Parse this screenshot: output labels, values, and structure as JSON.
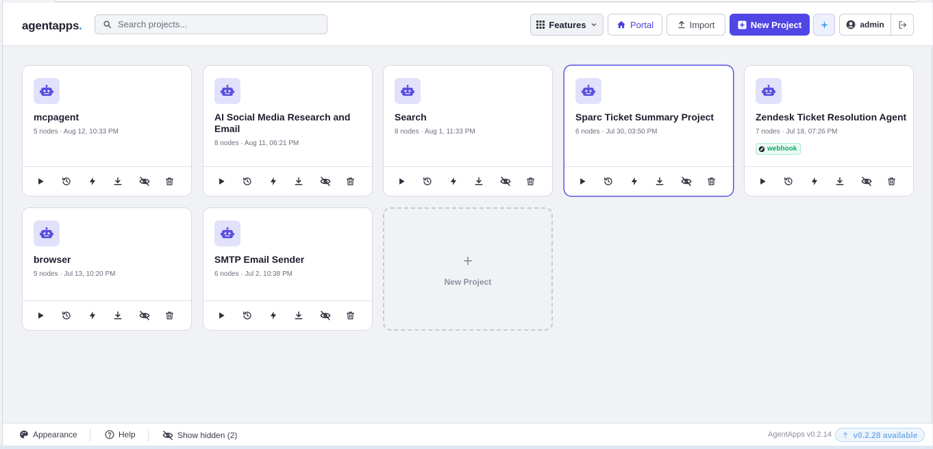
{
  "app": {
    "logo_part1": "agent",
    "logo_part2": "apps",
    "logo_dot": "."
  },
  "search": {
    "placeholder": "Search projects..."
  },
  "toolbar": {
    "features_label": "Features",
    "portal_label": "Portal",
    "import_label": "Import",
    "new_project_label": "New Project",
    "user_label": "admin"
  },
  "projects": [
    {
      "title": "mcpagent",
      "meta": "5 nodes · Aug 12, 10:33 PM",
      "badge": "",
      "selected": false
    },
    {
      "title": "AI Social Media Research and Email",
      "meta": "8 nodes · Aug 11, 06:21 PM",
      "badge": "",
      "selected": false
    },
    {
      "title": "Search",
      "meta": "8 nodes · Aug 1, 11:33 PM",
      "badge": "",
      "selected": false
    },
    {
      "title": "Sparc Ticket Summary Project",
      "meta": "6 nodes · Jul 30, 03:50 PM",
      "badge": "",
      "selected": true
    },
    {
      "title": "Zendesk Ticket Resolution Agent",
      "meta": "7 nodes · Jul 18, 07:26 PM",
      "badge": "webhook",
      "selected": false
    },
    {
      "title": "browser",
      "meta": "5 nodes · Jul 13, 10:20 PM",
      "badge": "",
      "selected": false
    },
    {
      "title": "SMTP Email Sender",
      "meta": "6 nodes · Jul 2, 10:38 PM",
      "badge": "",
      "selected": false
    }
  ],
  "card_actions": [
    "play-icon",
    "history-icon",
    "lightning-icon",
    "download-icon",
    "eye-off-icon",
    "trash-icon"
  ],
  "new_card": {
    "plus": "+",
    "label": "New Project"
  },
  "footer": {
    "appearance_label": "Appearance",
    "help_label": "Help",
    "show_hidden_label": "Show hidden (2)",
    "version_label": "AgentApps v0.2.14",
    "update_label": "v0.2.28 available"
  },
  "colors": {
    "accent": "#4f46e5",
    "avatar_bg": "#e1e1fb",
    "webhook": "#13a86b",
    "update": "#7fb3ea"
  }
}
